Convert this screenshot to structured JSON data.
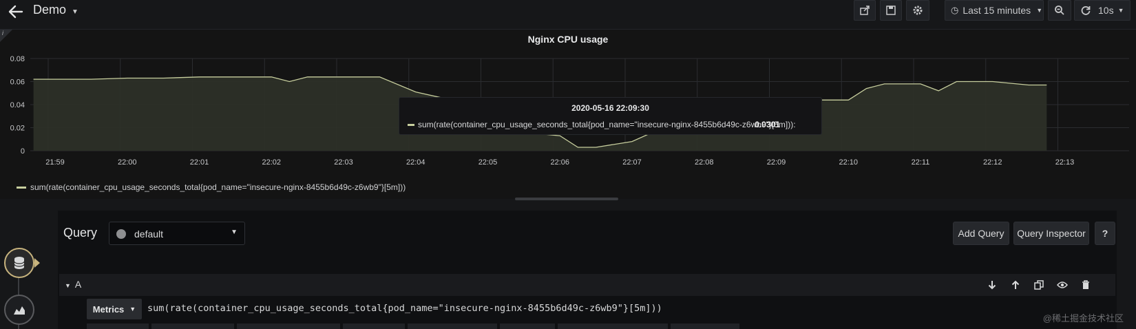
{
  "header": {
    "dashboard_title": "Demo",
    "time_range": "Last 15 minutes",
    "refresh_interval": "10s"
  },
  "panel": {
    "title": "Nginx CPU usage",
    "info_label": "i",
    "legend": "sum(rate(container_cpu_usage_seconds_total{pod_name=\"insecure-nginx-8455b6d49c-z6wb9\"}[5m]))",
    "series_color": "#c8cf9e",
    "tooltip": {
      "time": "2020-05-16 22:09:30",
      "series": "sum(rate(container_cpu_usage_seconds_total{pod_name=\"insecure-nginx-8455b6d49c-z6wb9\"}[5m])):",
      "value": "0.0301"
    }
  },
  "chart_data": {
    "type": "area",
    "title": "Nginx CPU usage",
    "x_ticks": [
      "21:59",
      "22:00",
      "22:01",
      "22:02",
      "22:03",
      "22:04",
      "22:05",
      "22:06",
      "22:07",
      "22:08",
      "22:09",
      "22:10",
      "22:11",
      "22:12",
      "22:13"
    ],
    "y_ticks": [
      "0",
      "0.02",
      "0.04",
      "0.06",
      "0.08"
    ],
    "ylim": [
      0,
      0.08
    ],
    "series": [
      {
        "name": "sum(rate(container_cpu_usage_seconds_total{pod_name=\"insecure-nginx-8455b6d49c-z6wb9\"}[5m]))",
        "x": [
          -0.3,
          0,
          0.5,
          1,
          1.5,
          2,
          2.5,
          3,
          3.25,
          3.5,
          4,
          4.5,
          5,
          5.5,
          6,
          6.5,
          7,
          7.25,
          7.5,
          8,
          8.25,
          8.5,
          9,
          9.25,
          9.5,
          10,
          10.25,
          10.5,
          11,
          11.25,
          11.5,
          12,
          12.25,
          12.5,
          13,
          13.5,
          13.75
        ],
        "y": [
          0.062,
          0.062,
          0.062,
          0.063,
          0.063,
          0.064,
          0.064,
          0.064,
          0.06,
          0.064,
          0.064,
          0.064,
          0.051,
          0.044,
          0.017,
          0.016,
          0.013,
          0.003,
          0.003,
          0.008,
          0.015,
          0.015,
          0.015,
          0.022,
          0.03,
          0.03,
          0.044,
          0.044,
          0.044,
          0.054,
          0.058,
          0.058,
          0.052,
          0.06,
          0.06,
          0.057,
          0.057
        ]
      }
    ],
    "grid": true,
    "legend_position": "bottom-left"
  },
  "query": {
    "label": "Query",
    "datasource": "default",
    "add_query": "Add Query",
    "query_inspector": "Query Inspector",
    "help": "?",
    "row_label": "A",
    "metrics_label": "Metrics",
    "expression": "sum(rate(container_cpu_usage_seconds_total{pod_name=\"insecure-nginx-8455b6d49c-z6wb9\"}[5m]))"
  },
  "watermark": "@稀土掘金技术社区"
}
